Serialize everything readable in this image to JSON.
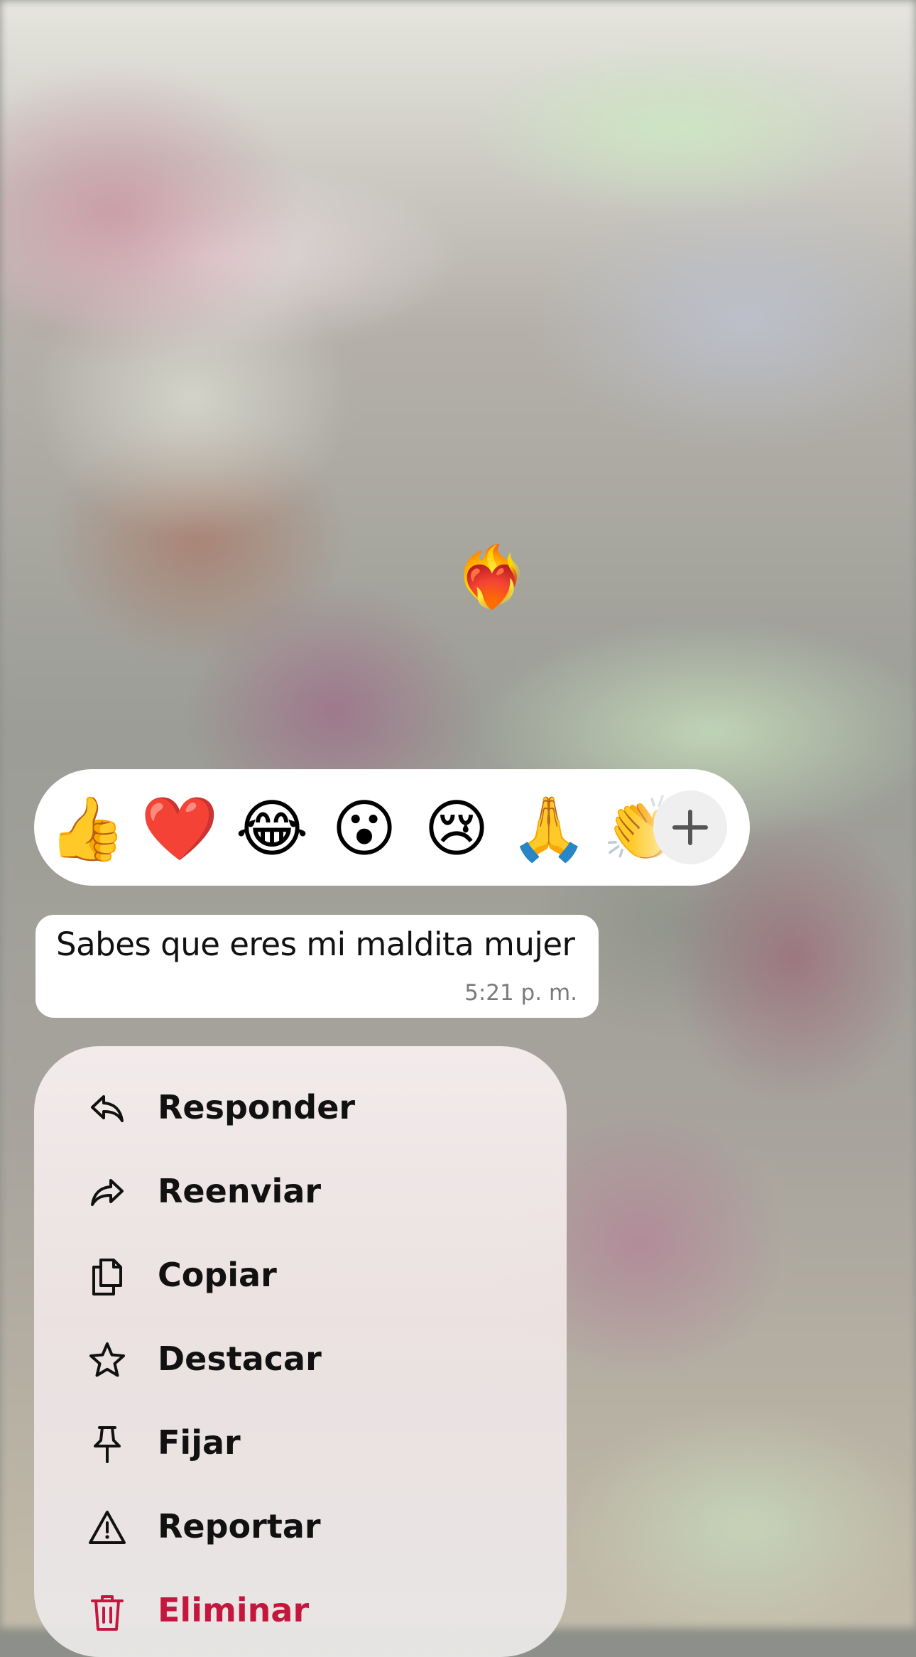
{
  "floating_reaction": "❤️‍🔥",
  "reactions": {
    "items": [
      "👍",
      "❤️",
      "😂",
      "😮",
      "😢",
      "🙏",
      "👏"
    ],
    "more_icon": "plus-icon"
  },
  "message": {
    "text": "Sabes que eres mi maldita mujer",
    "time": "5:21 p. m."
  },
  "menu": {
    "items": [
      {
        "label": "Responder",
        "icon": "reply-icon"
      },
      {
        "label": "Reenviar",
        "icon": "forward-icon"
      },
      {
        "label": "Copiar",
        "icon": "copy-icon"
      },
      {
        "label": "Destacar",
        "icon": "star-icon"
      },
      {
        "label": "Fijar",
        "icon": "pin-icon"
      },
      {
        "label": "Reportar",
        "icon": "warning-icon"
      },
      {
        "label": "Eliminar",
        "icon": "trash-icon"
      }
    ]
  },
  "colors": {
    "danger": "#c5173e",
    "menu_bg": "#efe6e6",
    "bubble_bg": "#ffffff"
  }
}
